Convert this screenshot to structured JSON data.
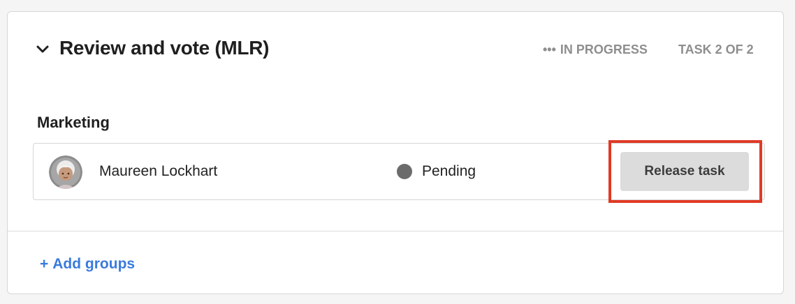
{
  "task": {
    "title": "Review and vote (MLR)",
    "status_dots": "•••",
    "status_label": "IN PROGRESS",
    "task_count": "TASK 2 OF 2"
  },
  "group": {
    "label": "Marketing",
    "members": [
      {
        "name": "Maureen Lockhart",
        "status": "Pending",
        "action_label": "Release task"
      }
    ]
  },
  "footer": {
    "add_plus": "+",
    "add_label": "Add groups"
  },
  "colors": {
    "accent_link": "#3a7bdc",
    "highlight_border": "#e03a25",
    "pending_dot": "#6b6b6b",
    "muted_text": "#8e8e8e"
  },
  "icons": {
    "collapse": "chevron-down-icon",
    "avatar": "user-avatar",
    "status": "status-dot-icon"
  }
}
